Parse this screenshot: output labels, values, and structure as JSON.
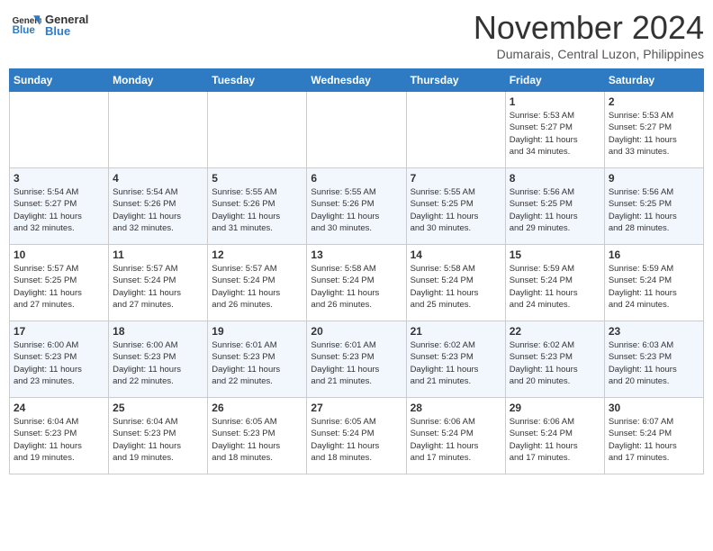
{
  "header": {
    "logo_general": "General",
    "logo_blue": "Blue",
    "month_title": "November 2024",
    "location": "Dumarais, Central Luzon, Philippines"
  },
  "weekdays": [
    "Sunday",
    "Monday",
    "Tuesday",
    "Wednesday",
    "Thursday",
    "Friday",
    "Saturday"
  ],
  "weeks": [
    [
      {
        "day": "",
        "info": ""
      },
      {
        "day": "",
        "info": ""
      },
      {
        "day": "",
        "info": ""
      },
      {
        "day": "",
        "info": ""
      },
      {
        "day": "",
        "info": ""
      },
      {
        "day": "1",
        "info": "Sunrise: 5:53 AM\nSunset: 5:27 PM\nDaylight: 11 hours\nand 34 minutes."
      },
      {
        "day": "2",
        "info": "Sunrise: 5:53 AM\nSunset: 5:27 PM\nDaylight: 11 hours\nand 33 minutes."
      }
    ],
    [
      {
        "day": "3",
        "info": "Sunrise: 5:54 AM\nSunset: 5:27 PM\nDaylight: 11 hours\nand 32 minutes."
      },
      {
        "day": "4",
        "info": "Sunrise: 5:54 AM\nSunset: 5:26 PM\nDaylight: 11 hours\nand 32 minutes."
      },
      {
        "day": "5",
        "info": "Sunrise: 5:55 AM\nSunset: 5:26 PM\nDaylight: 11 hours\nand 31 minutes."
      },
      {
        "day": "6",
        "info": "Sunrise: 5:55 AM\nSunset: 5:26 PM\nDaylight: 11 hours\nand 30 minutes."
      },
      {
        "day": "7",
        "info": "Sunrise: 5:55 AM\nSunset: 5:25 PM\nDaylight: 11 hours\nand 30 minutes."
      },
      {
        "day": "8",
        "info": "Sunrise: 5:56 AM\nSunset: 5:25 PM\nDaylight: 11 hours\nand 29 minutes."
      },
      {
        "day": "9",
        "info": "Sunrise: 5:56 AM\nSunset: 5:25 PM\nDaylight: 11 hours\nand 28 minutes."
      }
    ],
    [
      {
        "day": "10",
        "info": "Sunrise: 5:57 AM\nSunset: 5:25 PM\nDaylight: 11 hours\nand 27 minutes."
      },
      {
        "day": "11",
        "info": "Sunrise: 5:57 AM\nSunset: 5:24 PM\nDaylight: 11 hours\nand 27 minutes."
      },
      {
        "day": "12",
        "info": "Sunrise: 5:57 AM\nSunset: 5:24 PM\nDaylight: 11 hours\nand 26 minutes."
      },
      {
        "day": "13",
        "info": "Sunrise: 5:58 AM\nSunset: 5:24 PM\nDaylight: 11 hours\nand 26 minutes."
      },
      {
        "day": "14",
        "info": "Sunrise: 5:58 AM\nSunset: 5:24 PM\nDaylight: 11 hours\nand 25 minutes."
      },
      {
        "day": "15",
        "info": "Sunrise: 5:59 AM\nSunset: 5:24 PM\nDaylight: 11 hours\nand 24 minutes."
      },
      {
        "day": "16",
        "info": "Sunrise: 5:59 AM\nSunset: 5:24 PM\nDaylight: 11 hours\nand 24 minutes."
      }
    ],
    [
      {
        "day": "17",
        "info": "Sunrise: 6:00 AM\nSunset: 5:23 PM\nDaylight: 11 hours\nand 23 minutes."
      },
      {
        "day": "18",
        "info": "Sunrise: 6:00 AM\nSunset: 5:23 PM\nDaylight: 11 hours\nand 22 minutes."
      },
      {
        "day": "19",
        "info": "Sunrise: 6:01 AM\nSunset: 5:23 PM\nDaylight: 11 hours\nand 22 minutes."
      },
      {
        "day": "20",
        "info": "Sunrise: 6:01 AM\nSunset: 5:23 PM\nDaylight: 11 hours\nand 21 minutes."
      },
      {
        "day": "21",
        "info": "Sunrise: 6:02 AM\nSunset: 5:23 PM\nDaylight: 11 hours\nand 21 minutes."
      },
      {
        "day": "22",
        "info": "Sunrise: 6:02 AM\nSunset: 5:23 PM\nDaylight: 11 hours\nand 20 minutes."
      },
      {
        "day": "23",
        "info": "Sunrise: 6:03 AM\nSunset: 5:23 PM\nDaylight: 11 hours\nand 20 minutes."
      }
    ],
    [
      {
        "day": "24",
        "info": "Sunrise: 6:04 AM\nSunset: 5:23 PM\nDaylight: 11 hours\nand 19 minutes."
      },
      {
        "day": "25",
        "info": "Sunrise: 6:04 AM\nSunset: 5:23 PM\nDaylight: 11 hours\nand 19 minutes."
      },
      {
        "day": "26",
        "info": "Sunrise: 6:05 AM\nSunset: 5:23 PM\nDaylight: 11 hours\nand 18 minutes."
      },
      {
        "day": "27",
        "info": "Sunrise: 6:05 AM\nSunset: 5:24 PM\nDaylight: 11 hours\nand 18 minutes."
      },
      {
        "day": "28",
        "info": "Sunrise: 6:06 AM\nSunset: 5:24 PM\nDaylight: 11 hours\nand 17 minutes."
      },
      {
        "day": "29",
        "info": "Sunrise: 6:06 AM\nSunset: 5:24 PM\nDaylight: 11 hours\nand 17 minutes."
      },
      {
        "day": "30",
        "info": "Sunrise: 6:07 AM\nSunset: 5:24 PM\nDaylight: 11 hours\nand 17 minutes."
      }
    ]
  ]
}
